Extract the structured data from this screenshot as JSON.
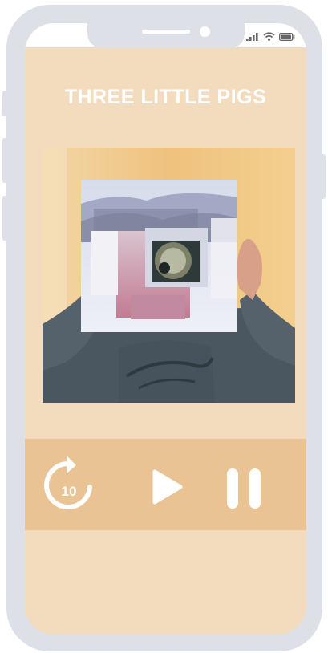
{
  "app": {
    "title": "THREE LITTLE PIGS"
  },
  "player": {
    "rewind_label": "10",
    "rewind_icon": "rewind-10-icon",
    "play_icon": "play-icon",
    "pause_icon": "pause-icon"
  },
  "colors": {
    "screen_background": "#f3dcbd",
    "control_bar": "#e9c393",
    "title_text": "#ffffff",
    "phone_frame": "#dde0e6"
  }
}
